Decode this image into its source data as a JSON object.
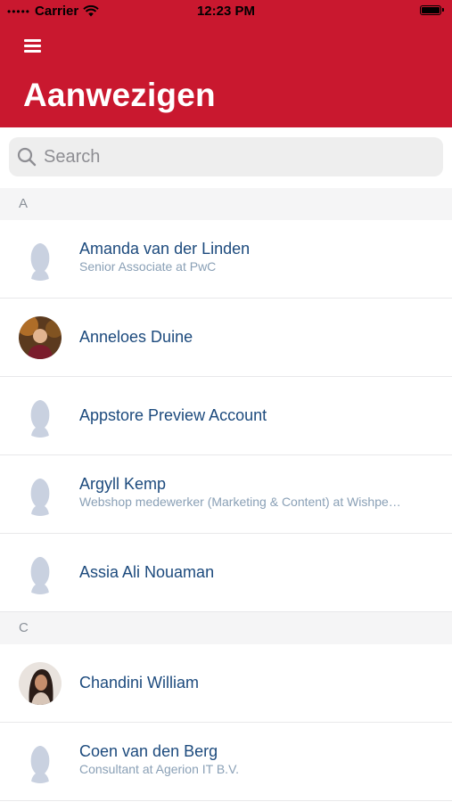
{
  "statusbar": {
    "carrier": "Carrier",
    "time": "12:23 PM"
  },
  "header": {
    "title": "Aanwezigen"
  },
  "search": {
    "placeholder": "Search"
  },
  "sections": [
    {
      "letter": "A",
      "people": [
        {
          "name": "Amanda van der Linden",
          "subtitle": "Senior Associate at PwC",
          "avatar": "placeholder"
        },
        {
          "name": "Anneloes Duine",
          "subtitle": "",
          "avatar": "photo"
        },
        {
          "name": "Appstore Preview Account",
          "subtitle": "",
          "avatar": "placeholder"
        },
        {
          "name": "Argyll Kemp",
          "subtitle": "Webshop medewerker (Marketing & Content) at Wishpe…",
          "avatar": "placeholder"
        },
        {
          "name": "Assia Ali Nouaman",
          "subtitle": "",
          "avatar": "placeholder"
        }
      ]
    },
    {
      "letter": "C",
      "people": [
        {
          "name": "Chandini William",
          "subtitle": "",
          "avatar": "photo"
        },
        {
          "name": "Coen van den Berg",
          "subtitle": "Consultant at Agerion IT B.V.",
          "avatar": "placeholder"
        }
      ]
    }
  ],
  "colors": {
    "header_bg": "#c9182f",
    "name_text": "#1c4a7d",
    "subtitle_text": "#8aa0b6",
    "avatar_placeholder": "#c9d1e0"
  }
}
